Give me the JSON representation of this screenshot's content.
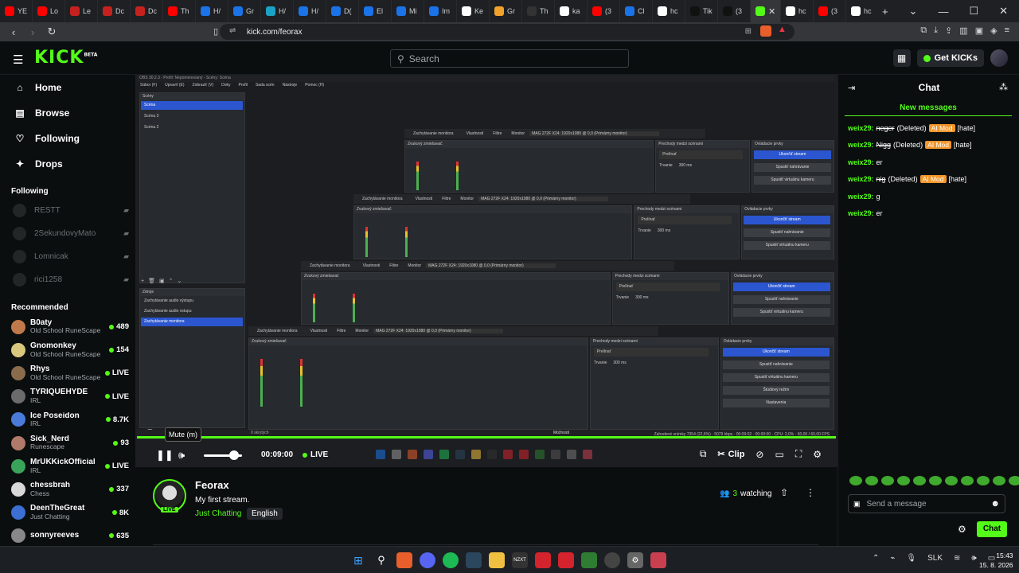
{
  "browser": {
    "tabs": [
      {
        "label": "YE",
        "color": "#ff0000"
      },
      {
        "label": "Lo",
        "color": "#ff0000"
      },
      {
        "label": "Le",
        "color": "#c5221f"
      },
      {
        "label": "Dc",
        "color": "#c5221f"
      },
      {
        "label": "Dc",
        "color": "#c5221f"
      },
      {
        "label": "Th",
        "color": "#ff0000"
      },
      {
        "label": "H/",
        "color": "#1a73e8"
      },
      {
        "label": "Gr",
        "color": "#1a73e8"
      },
      {
        "label": "H/",
        "color": "#1aa3c4"
      },
      {
        "label": "H/",
        "color": "#1a73e8"
      },
      {
        "label": "D(",
        "color": "#1a73e8"
      },
      {
        "label": "El",
        "color": "#1a73e8"
      },
      {
        "label": "Mi",
        "color": "#1a73e8"
      },
      {
        "label": "Im",
        "color": "#1a73e8"
      },
      {
        "label": "Ke",
        "color": "#ffffff"
      },
      {
        "label": "Gr",
        "color": "#f0a32b"
      },
      {
        "label": "Th",
        "color": "#333333"
      },
      {
        "label": "ka",
        "color": "#ffffff"
      },
      {
        "label": "(3",
        "color": "#ff0000"
      },
      {
        "label": "Cl",
        "color": "#1a73e8"
      },
      {
        "label": "hc",
        "color": "#ffffff"
      },
      {
        "label": "Tik",
        "color": "#111111"
      },
      {
        "label": "(3",
        "color": "#111111"
      }
    ],
    "active_tab": {
      "color": "#53fc18"
    },
    "tabs_after": [
      {
        "label": "hc",
        "color": "#ffffff"
      },
      {
        "label": "(3",
        "color": "#ff0000"
      },
      {
        "label": "hc",
        "color": "#ffffff"
      }
    ],
    "url": "kick.com/feorax"
  },
  "kick": {
    "logo": "KICK",
    "logo_beta": "BETA",
    "search_placeholder": "Search",
    "get_kicks": "Get KICKs",
    "nav": [
      {
        "label": "Home",
        "icon": "⌂"
      },
      {
        "label": "Browse",
        "icon": "▤"
      },
      {
        "label": "Following",
        "icon": "♡"
      },
      {
        "label": "Drops",
        "icon": "✦"
      }
    ],
    "following_header": "Following",
    "following": [
      "RESTT",
      "2SekundovyMato",
      "Lomnicak",
      "rici1258"
    ],
    "recommended_header": "Recommended",
    "recommended": [
      {
        "name": "B0aty",
        "category": "Old School RuneScape",
        "viewers": "489",
        "color": "#c0794a"
      },
      {
        "name": "Gnomonkey",
        "category": "Old School RuneScape",
        "viewers": "154",
        "color": "#d9c77e"
      },
      {
        "name": "Rhys",
        "category": "Old School RuneScape",
        "viewers": "LIVE",
        "color": "#8a6b4c"
      },
      {
        "name": "TYRIQUEHYDE",
        "category": "IRL",
        "viewers": "LIVE",
        "color": "#6b6b6b"
      },
      {
        "name": "Ice Poseidon",
        "category": "IRL",
        "viewers": "8.7K",
        "color": "#4b7bd9"
      },
      {
        "name": "Sick_Nerd",
        "category": "Runescape",
        "viewers": "93",
        "color": "#b07a6a"
      },
      {
        "name": "MrUKKickOfficial",
        "category": "IRL",
        "viewers": "LIVE",
        "color": "#3aa35a"
      },
      {
        "name": "chessbrah",
        "category": "Chess",
        "viewers": "337",
        "color": "#d8d8d8"
      },
      {
        "name": "DeenTheGreat",
        "category": "Just Chatting",
        "viewers": "8K",
        "color": "#3b6fd4"
      },
      {
        "name": "sonnyreeves",
        "category": "",
        "viewers": "635",
        "color": "#888888"
      }
    ]
  },
  "obs": {
    "menu": [
      "Súbor (F)",
      "Upraviť (E)",
      "Zobraziť (V)",
      "Doky",
      "Profil",
      "Sada scén",
      "Nástroje",
      "Pomoc (H)"
    ],
    "title": "OBS 30.2.3 - Profil: Nepomenovaný - Scény: Scéna",
    "scenes_label": "Scény",
    "scenes": [
      "Scéna",
      "Scéna 3",
      "Scéna 2"
    ],
    "sources_label": "Zdroje",
    "sources": [
      "Zachytávanie audio výstupu",
      "Zachytávanie audio vstupu",
      "Zachytávanie monitora"
    ],
    "capture_label": "Zachytávanie monitora",
    "properties_label": "Vlastnosti",
    "filters_label": "Filtre",
    "monitor_label": "Monitor",
    "monitor_value": "MAG 272F X24: 1920x1080 @ 0,0 (Primárny monitor)",
    "mixer_label": "Zvukový zmiešavač",
    "transitions_label": "Prechody medzi scénami",
    "transition_value": "Prelínať",
    "duration_label": "Trvanie",
    "duration_value": "300 ms",
    "controls_label": "Ovládacie prvky",
    "controls": [
      "Ukončiť stream",
      "Spustiť nahrávanie",
      "Spustiť virtuálnu kameru",
      "Štúdiový režim",
      "Nastavenia"
    ],
    "stats": "Zahodené snímky 7354 (22,6%)  ·  5079 kbps  ·  00:09:02  ·  00:00:00  ·  CPU: 2,0%  ·  60,00 / 60,00 FPS",
    "options_label": "Možnosti",
    "sources_count": "0 skrytých"
  },
  "player": {
    "tooltip": "Mute (m)",
    "time": "00:09:00",
    "live": "LIVE",
    "clip": "Clip",
    "volume": 0.8
  },
  "stream": {
    "channel": "Feorax",
    "live_tag": "LIVE",
    "title": "My first stream.",
    "category": "Just Chatting",
    "language": "English",
    "watching_count": "3",
    "watching_label": "watching"
  },
  "chat": {
    "title": "Chat",
    "new_messages": "New messages",
    "messages": [
      {
        "user": "weix29:",
        "text": "neger",
        "deleted": "(Deleted)",
        "badge": "AI Mod",
        "tag": "[hate]",
        "strike": true
      },
      {
        "user": "weix29:",
        "text": "Nigg",
        "deleted": "(Deleted)",
        "badge": "AI Mod",
        "tag": "[hate]",
        "strike": true
      },
      {
        "user": "weix29:",
        "text": "er",
        "deleted": "",
        "badge": "",
        "tag": "",
        "strike": false
      },
      {
        "user": "weix29:",
        "text": "nig",
        "deleted": "(Deleted)",
        "badge": "AI Mod",
        "tag": "[hate]",
        "strike": true
      },
      {
        "user": "weix29:",
        "text": "g",
        "deleted": "",
        "badge": "",
        "tag": "",
        "strike": false
      },
      {
        "user": "weix29:",
        "text": "er",
        "deleted": "",
        "badge": "",
        "tag": "",
        "strike": false
      }
    ],
    "input_placeholder": "Send a message",
    "send": "Chat"
  },
  "taskbar": {
    "lang": "SLK",
    "time": "15:43",
    "date": "15. 8. 2026"
  }
}
